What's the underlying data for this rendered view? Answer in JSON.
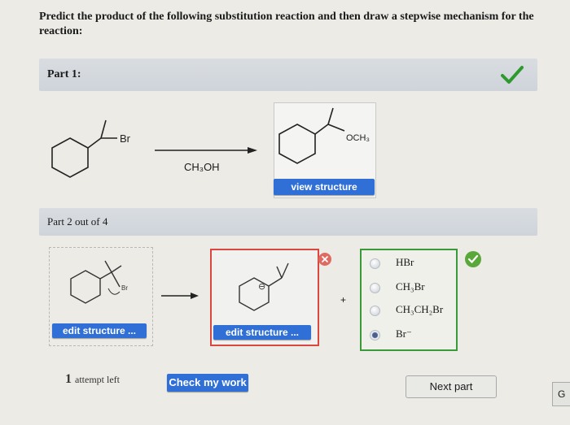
{
  "question": "Predict the product of the following substitution reaction and then draw a stepwise mechanism for the reaction:",
  "part1": {
    "label": "Part 1:",
    "reactant_label": "Br",
    "reagent": "CH₃OH",
    "product_label": "OCH₃",
    "view_structure": "view structure"
  },
  "part2": {
    "label": "Part 2 out of 4",
    "reactant_label": "Br",
    "product_charge": "⊖",
    "plus": "+",
    "edit_structure": "edit structure ...",
    "choices": [
      "HBr",
      "CH₃Br",
      "CH₃CH₂Br",
      "Br⁻"
    ],
    "selected_choice": 3
  },
  "footer": {
    "attempt_count": "1",
    "attempt_text": "attempt left",
    "check_my_work": "Check my work",
    "next_part": "Next part",
    "go": "G"
  },
  "colors": {
    "accent_blue": "#2f6fd6",
    "correct_green": "#3a9a3a",
    "error_red": "#d9473e"
  }
}
